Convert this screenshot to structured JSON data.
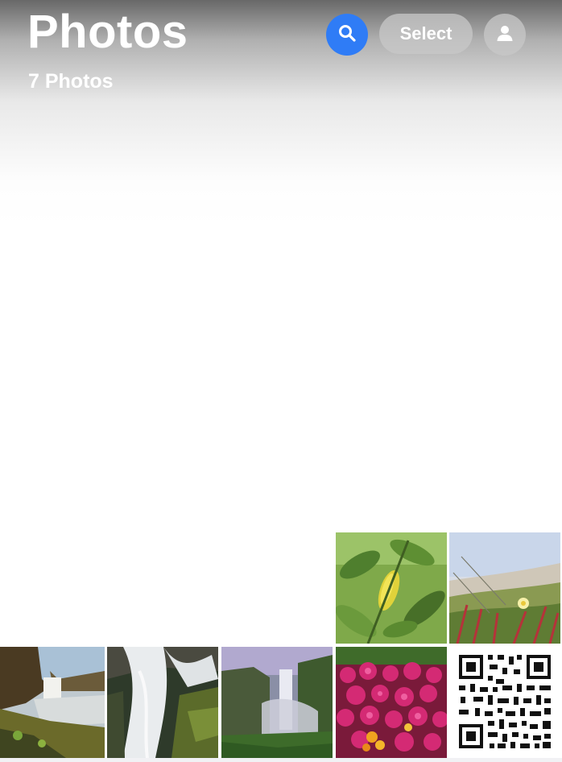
{
  "header": {
    "title": "Photos",
    "subtitle": "7 Photos",
    "select_label": "Select"
  },
  "icons": {
    "search": "search-icon",
    "account": "person-icon"
  },
  "colors": {
    "accent": "#2f7cf6",
    "button_glass": "#c8c8c8"
  },
  "grid": {
    "photo_count": 7,
    "photos": [
      {
        "subject": "green leaves"
      },
      {
        "subject": "beach grass and flower"
      },
      {
        "subject": "waterfall canyon"
      },
      {
        "subject": "waterfall long exposure"
      },
      {
        "subject": "waterfall with mist"
      },
      {
        "subject": "pink flowers"
      },
      {
        "subject": "qr code"
      }
    ]
  }
}
